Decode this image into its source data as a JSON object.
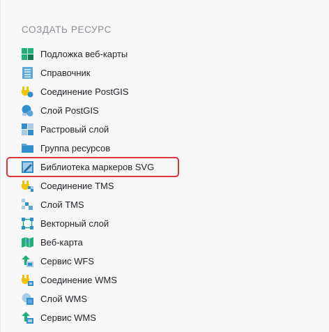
{
  "heading": "СОЗДАТЬ РЕСУРС",
  "items": [
    {
      "label": "Подложка веб-карты",
      "icon": "basemap-icon"
    },
    {
      "label": "Справочник",
      "icon": "lookup-table-icon"
    },
    {
      "label": "Соединение PostGIS",
      "icon": "postgis-connection-icon"
    },
    {
      "label": "Слой PostGIS",
      "icon": "postgis-layer-icon"
    },
    {
      "label": "Растровый слой",
      "icon": "raster-layer-icon"
    },
    {
      "label": "Группа ресурсов",
      "icon": "resource-group-icon"
    },
    {
      "label": "Библиотека маркеров SVG",
      "icon": "svg-marker-library-icon"
    },
    {
      "label": "Соединение TMS",
      "icon": "tms-connection-icon"
    },
    {
      "label": "Слой TMS",
      "icon": "tms-layer-icon"
    },
    {
      "label": "Векторный слой",
      "icon": "vector-layer-icon"
    },
    {
      "label": "Веб-карта",
      "icon": "webmap-icon"
    },
    {
      "label": "Сервис WFS",
      "icon": "wfs-service-icon"
    },
    {
      "label": "Соединение WMS",
      "icon": "wms-connection-icon"
    },
    {
      "label": "Слой WMS",
      "icon": "wms-layer-icon"
    },
    {
      "label": "Сервис WMS",
      "icon": "wms-service-icon"
    }
  ],
  "highlighted_item": "Библиотека маркеров SVG",
  "colors": {
    "highlight_border": "#d9363e",
    "heading_text": "#8b9096",
    "item_text": "#1f2327",
    "green": "#1fb07a",
    "blue": "#2f8fcf",
    "yellow": "#f2c300"
  }
}
